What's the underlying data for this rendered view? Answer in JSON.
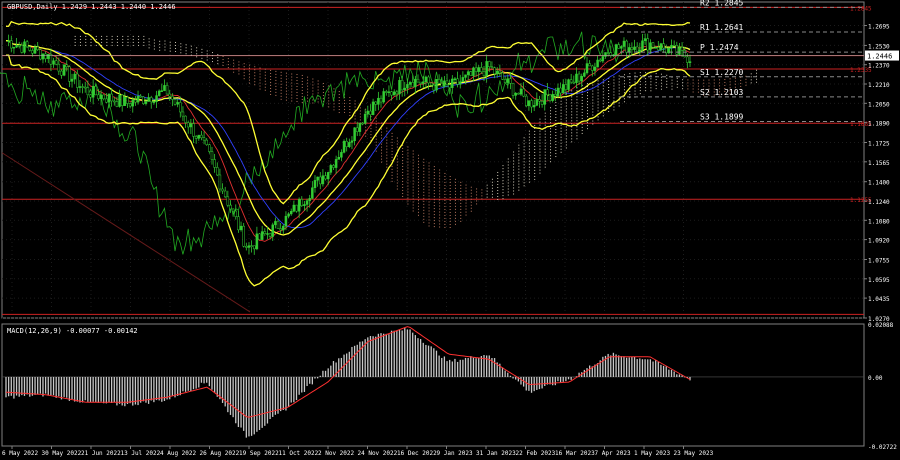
{
  "header": {
    "symbol_line": "GBPUSD,Daily  1.2429 1.2443 1.2440 1.2446",
    "macd_line": "MACD(12,26,9) -0.00077 -0.00142"
  },
  "colors": {
    "background": "#000000",
    "grid": "#7f7f7f",
    "bull_candle": "#33cc33",
    "bear_candle": "#000000",
    "candle_outline": "#33cc33",
    "ma_band": "#ffff33",
    "kumo_bull": "#cfc9b6",
    "kumo_bear": "#b87860",
    "chikou": "#22aa22",
    "tenkan": "#e03030",
    "kijun": "#3040ff",
    "pivot_line": "#8a8a8a",
    "level_line": "#cc2222",
    "macd_hist": "#c8c8c8",
    "macd_signal": "#ff3030",
    "axis_text": "#ffffff",
    "current_price_bg": "#ffffff"
  },
  "chart_data": [
    {
      "type": "line",
      "title": "GBPUSD,Daily",
      "ylim": [
        1.027,
        1.289
      ],
      "yticks": [
        "1.2695",
        "1.2530",
        "1.2370",
        "1.2210",
        "1.2050",
        "1.1890",
        "1.1725",
        "1.1565",
        "1.1400",
        "1.1240",
        "1.1080",
        "1.0920",
        "1.0755",
        "1.0595",
        "1.0435",
        "1.0270"
      ],
      "ytick_values": [
        1.2695,
        1.253,
        1.237,
        1.221,
        1.205,
        1.189,
        1.1725,
        1.1565,
        1.14,
        1.124,
        1.108,
        1.092,
        1.0755,
        1.0595,
        1.0435,
        1.027
      ],
      "x_categories": [
        "6 May 2022",
        "30 May 2022",
        "21 Jun 2022",
        "13 Jul 2022",
        "4 Aug 2022",
        "26 Aug 2022",
        "19 Sep 2022",
        "11 Oct 2022",
        "2 Nov 2022",
        "24 Nov 2022",
        "16 Dec 2022",
        "9 Jan 2023",
        "31 Jan 2023",
        "22 Feb 2023",
        "16 Mar 2023",
        "7 Apr 2023",
        "1 May 2023",
        "23 May 2023"
      ],
      "current_price": "1.2446",
      "pivots": [
        {
          "label": "R2",
          "value": 1.2845,
          "text": "1.2845"
        },
        {
          "label": "R1",
          "value": 1.2641,
          "text": "1.2641"
        },
        {
          "label": "P",
          "value": 1.2474,
          "text": "1.2474"
        },
        {
          "label": "S1",
          "value": 1.227,
          "text": "1.2270"
        },
        {
          "label": "S2",
          "value": 1.2103,
          "text": "1.2103"
        },
        {
          "label": "S3",
          "value": 1.1899,
          "text": "1.1899"
        }
      ],
      "horizontal_levels": [
        1.2845,
        1.2445,
        1.2335,
        1.1885,
        1.1255,
        1.03
      ],
      "level_tags": [
        "1.2845",
        "1.2335",
        "1.1885",
        "1.1255"
      ],
      "price_approx_by_category": [
        1.257,
        1.245,
        1.215,
        1.205,
        1.215,
        1.165,
        1.085,
        1.11,
        1.15,
        1.2,
        1.225,
        1.218,
        1.235,
        1.205,
        1.22,
        1.25,
        1.255,
        1.243
      ],
      "series": [
        {
          "name": "Close",
          "values": [
            1.257,
            1.245,
            1.215,
            1.205,
            1.215,
            1.165,
            1.085,
            1.11,
            1.15,
            1.2,
            1.225,
            1.218,
            1.235,
            1.205,
            1.22,
            1.25,
            1.255,
            1.243
          ]
        }
      ]
    },
    {
      "type": "bar",
      "title": "MACD(12,26,9)",
      "ylim": [
        -0.02722,
        0.02088
      ],
      "yticks": [
        "0.02088",
        "0.00",
        "-0.02722"
      ],
      "ytick_values": [
        0.02088,
        0.0,
        -0.02722
      ],
      "series": [
        {
          "name": "MACD",
          "values": [
            -0.008,
            -0.007,
            -0.01,
            -0.011,
            -0.009,
            -0.002,
            -0.024,
            -0.012,
            0.004,
            0.016,
            0.019,
            0.006,
            0.009,
            -0.006,
            -0.001,
            0.009,
            0.007,
            -0.001
          ]
        },
        {
          "name": "Signal",
          "values": [
            -0.006,
            -0.007,
            -0.01,
            -0.01,
            -0.008,
            -0.004,
            -0.016,
            -0.012,
            -0.002,
            0.014,
            0.02,
            0.009,
            0.007,
            -0.003,
            -0.002,
            0.008,
            0.008,
            -0.001
          ]
        }
      ]
    }
  ]
}
